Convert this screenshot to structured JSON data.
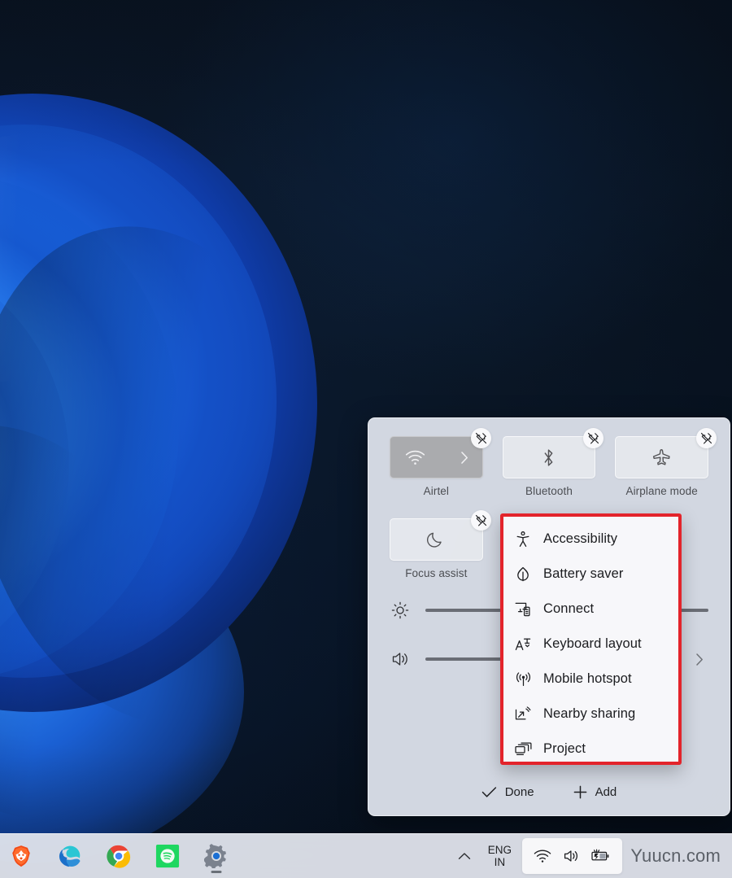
{
  "desktop": {
    "wallpaper_name": "windows-11-bloom-wallpaper",
    "background_color": "#08131f",
    "accent_color": "#1f6df5"
  },
  "quick_settings": {
    "panel_name": "Quick Settings",
    "tiles": [
      {
        "id": "wifi",
        "label": "Airtel",
        "icon": "wifi-icon",
        "state": "on",
        "has_chevron": true,
        "unpin_tooltip": "Unpin"
      },
      {
        "id": "bluetooth",
        "label": "Bluetooth",
        "icon": "bluetooth-icon",
        "state": "off",
        "has_chevron": false,
        "unpin_tooltip": "Unpin"
      },
      {
        "id": "airplane",
        "label": "Airplane mode",
        "icon": "airplane-icon",
        "state": "off",
        "has_chevron": false,
        "unpin_tooltip": "Unpin"
      },
      {
        "id": "focus-assist",
        "label": "Focus assist",
        "icon": "moon-icon",
        "state": "off",
        "has_chevron": false,
        "unpin_tooltip": "Unpin"
      }
    ],
    "sliders": [
      {
        "id": "brightness",
        "icon": "brightness-icon",
        "value": 50,
        "has_next": false
      },
      {
        "id": "volume",
        "icon": "volume-icon",
        "value": 100,
        "has_next": true
      }
    ],
    "footer": {
      "done_label": "Done",
      "done_icon": "check-icon",
      "add_label": "Add",
      "add_icon": "plus-icon"
    }
  },
  "context_menu": {
    "highlight_color": "#e3242b",
    "items": [
      {
        "label": "Accessibility",
        "icon": "accessibility-icon"
      },
      {
        "label": "Battery saver",
        "icon": "leaf-icon"
      },
      {
        "label": "Connect",
        "icon": "connect-icon"
      },
      {
        "label": "Keyboard layout",
        "icon": "keyboard-layout-icon"
      },
      {
        "label": "Mobile hotspot",
        "icon": "hotspot-icon"
      },
      {
        "label": "Nearby sharing",
        "icon": "share-icon"
      },
      {
        "label": "Project",
        "icon": "project-icon"
      }
    ]
  },
  "taskbar": {
    "apps": [
      {
        "name": "Brave",
        "icon": "brave-icon",
        "running": false
      },
      {
        "name": "Edge",
        "icon": "edge-icon",
        "running": true
      },
      {
        "name": "Chrome",
        "icon": "chrome-icon",
        "running": false
      },
      {
        "name": "Spotify",
        "icon": "spotify-icon",
        "running": false
      },
      {
        "name": "Settings",
        "icon": "settings-icon",
        "running": true
      }
    ],
    "tray": {
      "overflow_icon": "chevron-up-icon",
      "language_primary": "ENG",
      "language_secondary": "IN",
      "cluster_icons": [
        "wifi-icon",
        "volume-icon",
        "battery-charging-icon"
      ],
      "watermark": "Yuucn.com"
    }
  }
}
